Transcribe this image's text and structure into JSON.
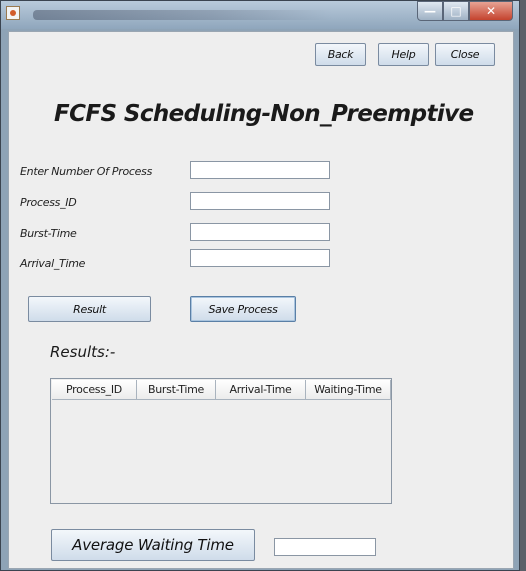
{
  "window": {
    "title_icon": "java-icon",
    "controls": {
      "minimize": "—",
      "maximize": "□",
      "close": "✕"
    }
  },
  "toolbar": {
    "back_label": "Back",
    "help_label": "Help",
    "close_label": "Close"
  },
  "heading": "FCFS Scheduling-Non_Preemptive",
  "form": {
    "fields": [
      {
        "label": "Enter Number Of Process",
        "value": ""
      },
      {
        "label": "Process_ID",
        "value": ""
      },
      {
        "label": "Burst-Time",
        "value": ""
      },
      {
        "label": "Arrival_Time",
        "value": ""
      }
    ]
  },
  "actions": {
    "result_label": "Result",
    "save_label": "Save Process"
  },
  "results": {
    "label": "Results:-",
    "columns": [
      "Process_ID",
      "Burst-Time",
      "Arrival-Time",
      "Waiting-Time"
    ],
    "rows": []
  },
  "average": {
    "button_label": "Average Waiting Time",
    "value": ""
  }
}
